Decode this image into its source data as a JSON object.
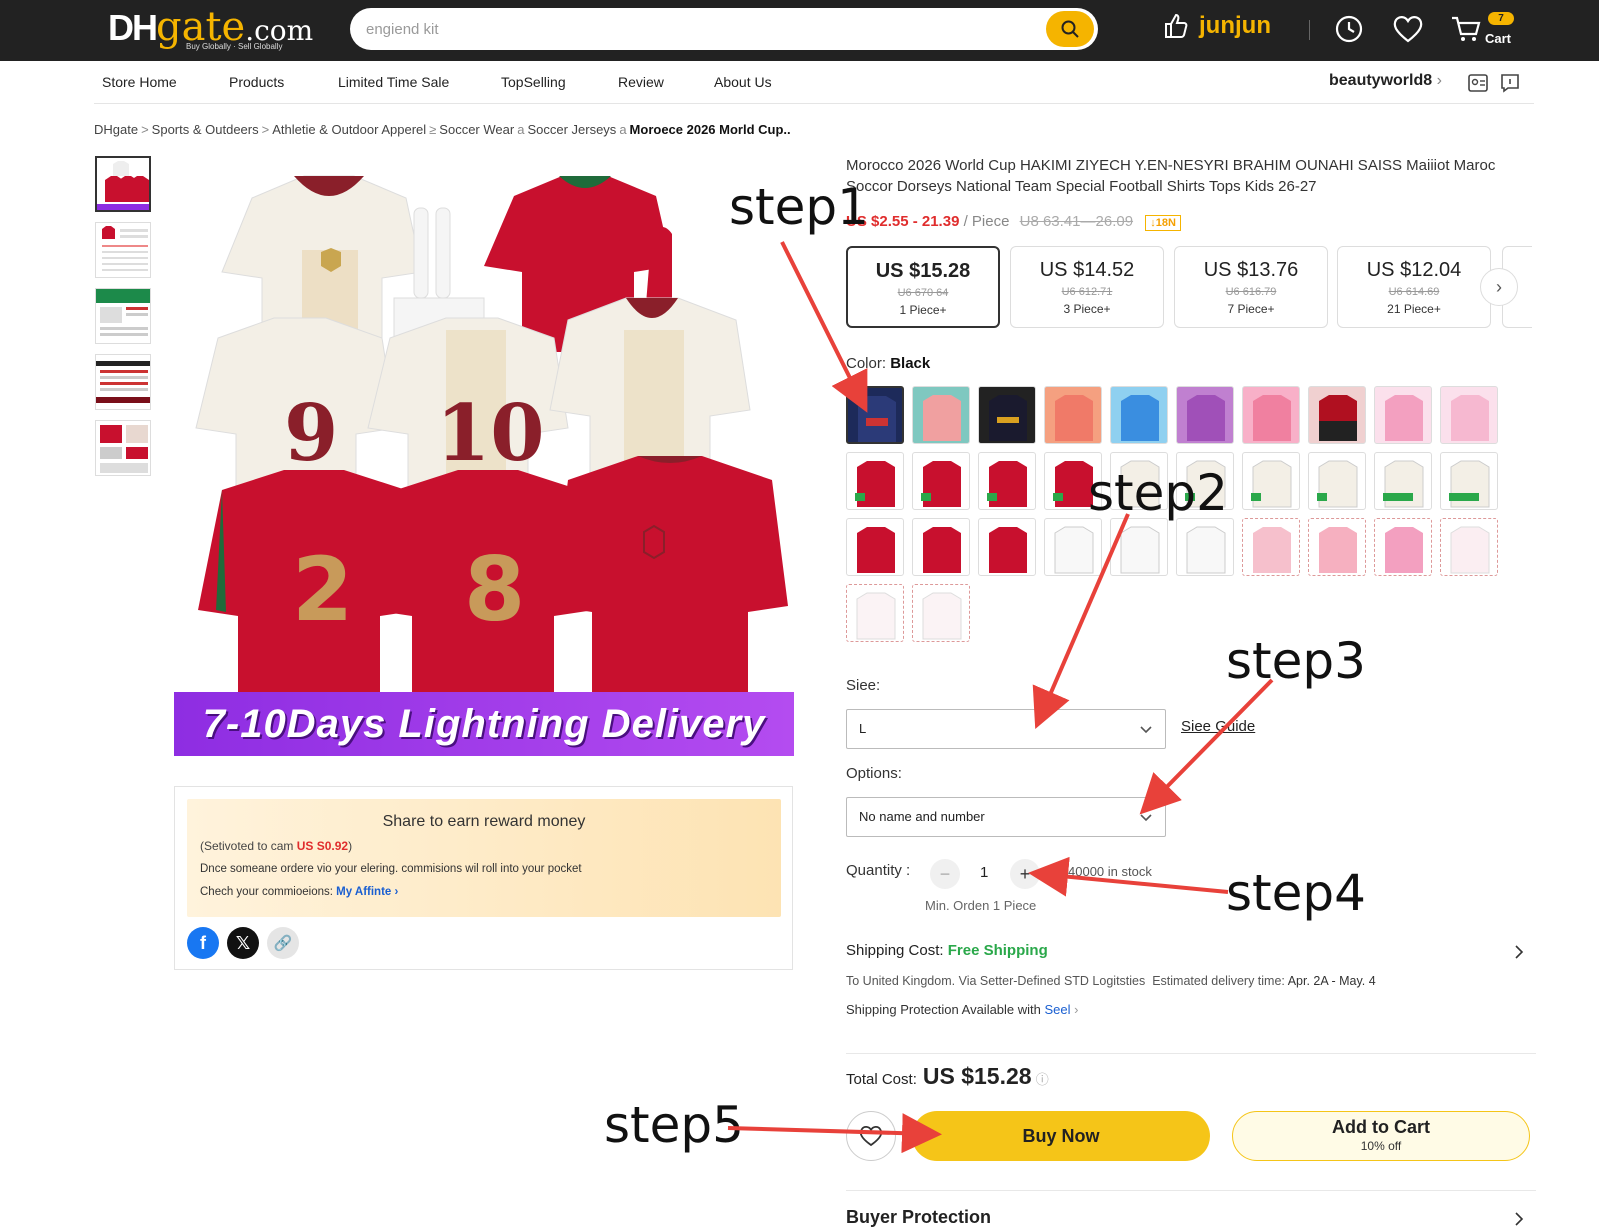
{
  "header": {
    "logo_dh": "DH",
    "logo_gate": "gate",
    "logo_com": ".com",
    "logo_tagline": "Buy Globally · Sell Globally",
    "search_placeholder": "engiend kit",
    "username": "junjun",
    "cart_count": "7",
    "cart_label": "Cart"
  },
  "store_nav": {
    "items": [
      "Store Home",
      "Products",
      "Limited Time Sale",
      "TopSelling",
      "Review",
      "About Us"
    ],
    "store_name": "beautyworld8"
  },
  "breadcrumb": [
    "DHgate",
    "Sports & Outdeers",
    "Athletie & Outdoor Apperel",
    "Soccer Wear",
    "Soccer Jerseys",
    "Moroece 2026 Morld Cup.."
  ],
  "product": {
    "title": "Morocco 2026 World Cup HAKIMI ZIYECH Y.EN-NESYRI BRAHIM OUNAHI SAISS Maiiiot Maroc Soccor Dorseys National Team Special Football Shirts Tops Kids 26-27",
    "price_range": "US $2.55 - 21.39",
    "price_unit": "/ Piece",
    "old_range": "U8 63.41—26.09",
    "discount_badge": "↓18N",
    "tiers": [
      {
        "price": "US $15.28",
        "old": "U6 670 64",
        "qty": "1 Piece+"
      },
      {
        "price": "US $14.52",
        "old": "U6 612.71",
        "qty": "3 Piece+"
      },
      {
        "price": "US $13.76",
        "old": "U6 616.79",
        "qty": "7 Piece+"
      },
      {
        "price": "US $12.04",
        "old": "U6 614.69",
        "qty": "21 Piece+"
      }
    ],
    "color_label": "Color:",
    "color_value": "Black",
    "delivery_banner": "7-10Days  Lightning  Delivery",
    "size_label": "Siee:",
    "size_value": "L",
    "size_guide": "Siee Guide",
    "options_label": "Options:",
    "options_value": "No name and number",
    "quantity_label": "Quantity :",
    "quantity_value": "1",
    "stock": "40000 in stock",
    "min_order": "Min. Orden 1 Piece",
    "shipping_label": "Shipping Cost:",
    "shipping_value": "Free Shipping",
    "shipping_to": "To United Kingdom.",
    "shipping_via": "Via Setter-Defined STD Logitsties",
    "delivery_time_label": "Estimated delivery time:",
    "delivery_time": "Apr. 2A - May. 4",
    "protection_text": "Shipping Protection Available with",
    "protection_link": "Seel",
    "total_label": "Total Cost:",
    "total_value": "US $15.28",
    "buy_now": "Buy Now",
    "add_to_cart": "Add to Cart",
    "add_to_cart_sub": "10% off",
    "buyer_protection": "Buyer Protection"
  },
  "share": {
    "title": "Share to earn reward money",
    "est_prefix": "(Setivoted to cam",
    "est_amount": "US S0.92",
    "est_suffix": ")",
    "line2": "Dnce someane ordere vio your elering. commisions wil roll into your pocket",
    "line3_prefix": "Chech your commioeions:",
    "line3_link": "My Affinte ›"
  },
  "annotations": [
    "step1",
    "step2",
    "step3",
    "step4",
    "step5"
  ],
  "colors": {
    "topbar": "#222222",
    "brand_yellow": "#f5b400",
    "price_red": "#e02d2d",
    "free_green": "#2aa84a",
    "delivery_purple": "#9b35e8",
    "arrow_red": "#e8413a"
  }
}
